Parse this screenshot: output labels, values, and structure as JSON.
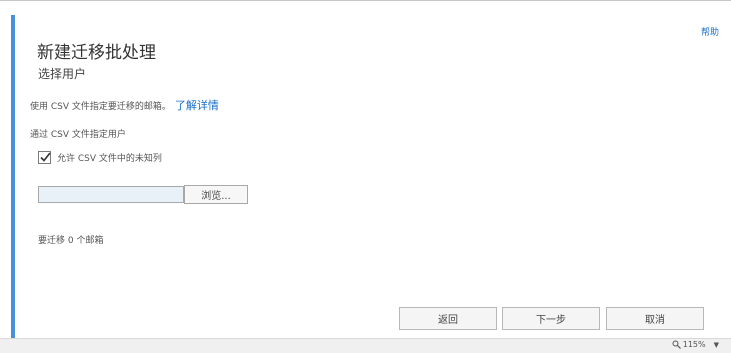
{
  "header": {
    "help_label": "帮助",
    "title": "新建迁移批处理",
    "subtitle": "选择用户"
  },
  "main": {
    "description": "使用 CSV 文件指定要迁移的邮箱。",
    "learn_more": "了解详情",
    "section_label": "通过 CSV 文件指定用户",
    "checkbox": {
      "label": "允许 CSV 文件中的未知列",
      "checked": true
    },
    "file_input": {
      "value": "",
      "placeholder": ""
    },
    "browse_label": "浏览...",
    "status": "要迁移 0 个邮箱"
  },
  "footer": {
    "back_label": "返回",
    "next_label": "下一步",
    "cancel_label": "取消"
  },
  "status_bar": {
    "zoom": "115%"
  },
  "colors": {
    "accent": "#4a90d9",
    "link": "#1a6fc9"
  }
}
